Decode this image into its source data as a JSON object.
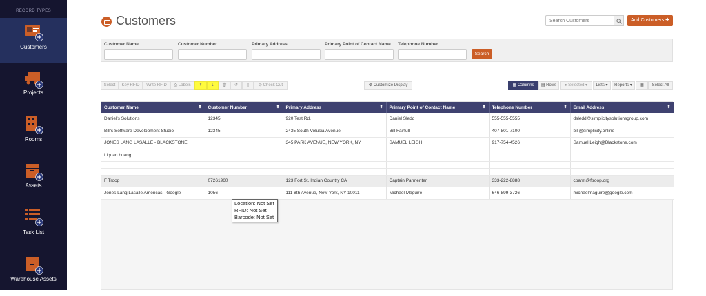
{
  "sidebar": {
    "heading": "RECORD TYPES",
    "items": [
      {
        "label": "Customers",
        "icon": "customers-icon",
        "active": true
      },
      {
        "label": "Projects",
        "icon": "truck-icon",
        "active": false
      },
      {
        "label": "Rooms",
        "icon": "building-icon",
        "active": false
      },
      {
        "label": "Assets",
        "icon": "box-icon",
        "active": false
      },
      {
        "label": "Task List",
        "icon": "list-icon",
        "active": false
      },
      {
        "label": "Warehouse Assets",
        "icon": "box-icon",
        "active": false
      }
    ],
    "accent_color": "#cb5e27"
  },
  "header": {
    "title": "Customers",
    "search_placeholder": "Search Customers",
    "add_label": "Add Customers ✚"
  },
  "filters": {
    "fields": [
      "Customer Name",
      "Customer Number",
      "Primary Address",
      "Primary Point of Contact Name",
      "Telephone Number"
    ],
    "search_label": "Search"
  },
  "toolbar": {
    "select": "Select",
    "key_rfid": "Key RFID",
    "write_rfid": "Write RFID",
    "labels": "Labels",
    "check_out": "Check Out",
    "customize": "Customize Display",
    "columns": "Columns",
    "rows": "Rows",
    "selected": "Selected",
    "lists": "Lists",
    "reports": "Reports",
    "select_all": "Select All"
  },
  "table": {
    "columns": [
      "Customer Name",
      "Customer Number",
      "Primary Address",
      "Primary Point of Contact Name",
      "Telephone Number",
      "Email Address"
    ],
    "rows": [
      [
        "Daniel's Solutions",
        "12345",
        "920 Test Rd.",
        "Daniel Sledd",
        "555-555-5555",
        "dsledd@simplicitysolutionsgroup.com"
      ],
      [
        "Bill's Software Development Studio",
        "12345",
        "2435 South Volusia Avenue",
        "Bill Fairfull",
        "407-801-7100",
        "bill@simplicity.online"
      ],
      [
        "JONES LANG LASALLE - BLACKSTONE",
        "",
        "345 PARK AVENUE, NEW YORK, NY",
        "SAMUEL LEIGH",
        "917-754-4526",
        "Samuel.Leigh@Blackstone.com"
      ],
      [
        "Liquan huang",
        "",
        "",
        "",
        "",
        ""
      ],
      [
        "",
        "",
        "",
        "",
        "",
        ""
      ],
      [
        "F Troop",
        "07261960",
        "123 Fort St, Indian Country CA",
        "Captain Parmenter",
        "333-222-8888",
        "cparm@ftroop.org"
      ],
      [
        "Jones Lang Lasalle Americas - Google",
        "1056",
        "111 8th Avenue, New York, NY 10011",
        "Michael Maguire",
        "646-899-3726",
        "michaelmaguire@google.com"
      ]
    ]
  },
  "tooltip": {
    "location": "Location: Not Set",
    "rfid": "RFID: Not Set",
    "barcode": "Barcode: Not Set"
  }
}
